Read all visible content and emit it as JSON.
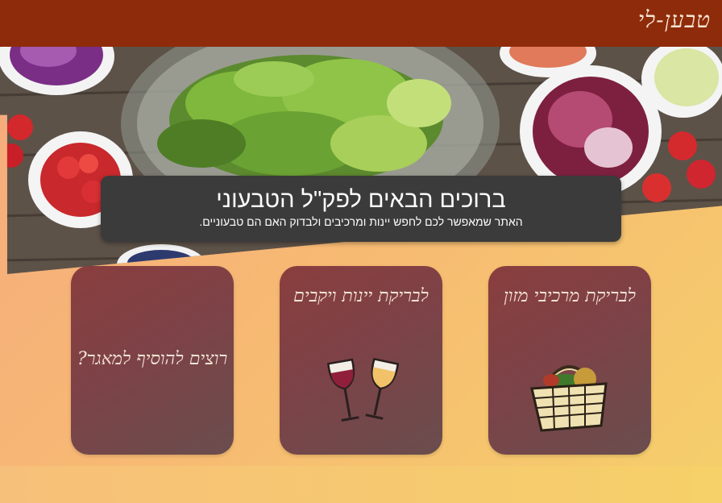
{
  "header": {
    "brand": "טבען-לי"
  },
  "hero": {
    "title": "ברוכים הבאים לפק\"ל הטבעוני",
    "subtitle": "האתר שמאפשר לכם לחפש יינות ומרכיבים ולבדוק האם הם טבעוניים."
  },
  "cards": {
    "food": {
      "label": "לבריקת מרכיבי מזון",
      "icon": "picnic-basket-icon"
    },
    "wine": {
      "label": "לבריקת יינות ויקבים",
      "icon": "wine-glasses-icon"
    },
    "add": {
      "label": "רוצים להוסיף למאגר?"
    }
  },
  "colors": {
    "topbar": "#8e2b0a",
    "card": "#7d4247",
    "welcome_box": "#3b3b3b"
  }
}
